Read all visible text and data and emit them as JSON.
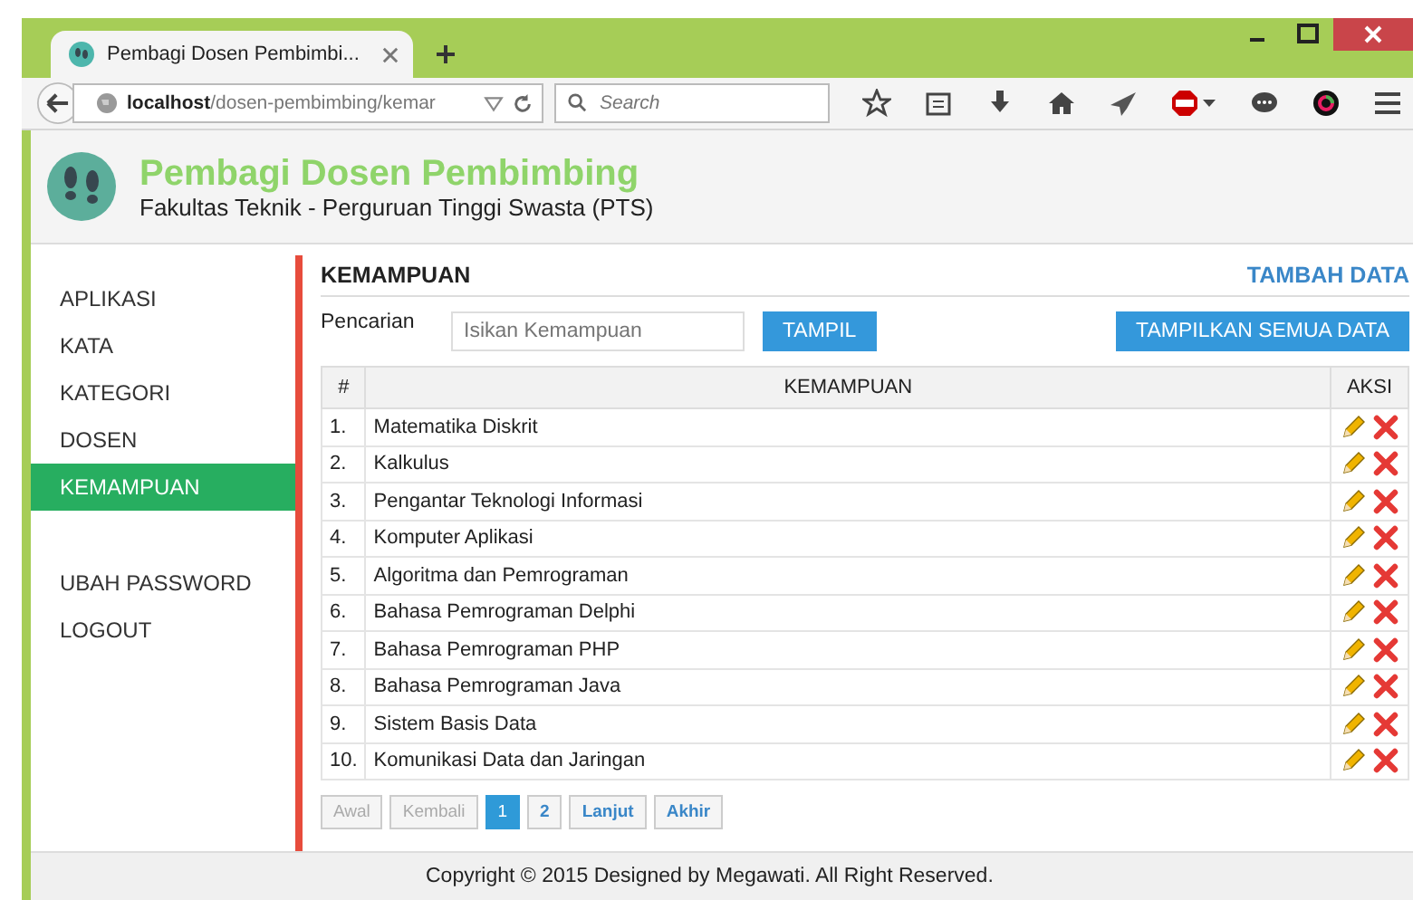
{
  "browser": {
    "tab_title": "Pembagi Dosen Pembimbi...",
    "url_host": "localhost",
    "url_path": "/dosen-pembimbing/kemar",
    "search_placeholder": "Search"
  },
  "header": {
    "title": "Pembagi Dosen Pembimbing",
    "subtitle": "Fakultas Teknik - Perguruan Tinggi Swasta (PTS)"
  },
  "sidebar": {
    "groups": [
      [
        {
          "label": "APLIKASI",
          "selected": false
        },
        {
          "label": "KATA",
          "selected": false
        },
        {
          "label": "KATEGORI",
          "selected": false
        },
        {
          "label": "DOSEN",
          "selected": false
        },
        {
          "label": "KEMAMPUAN",
          "selected": true
        }
      ],
      [
        {
          "label": "UBAH PASSWORD",
          "selected": false
        },
        {
          "label": "LOGOUT",
          "selected": false
        }
      ]
    ]
  },
  "main": {
    "title": "KEMAMPUAN",
    "add_link": "TAMBAH DATA",
    "search_label": "Pencarian",
    "search_placeholder": "Isikan Kemampuan",
    "search_button": "TAMPIL",
    "show_all_button": "TAMPILKAN SEMUA DATA"
  },
  "table": {
    "columns": [
      "#",
      "KEMAMPUAN",
      "AKSI"
    ],
    "rows": [
      {
        "no": "1.",
        "name": "Matematika Diskrit"
      },
      {
        "no": "2.",
        "name": "Kalkulus"
      },
      {
        "no": "3.",
        "name": "Pengantar Teknologi Informasi"
      },
      {
        "no": "4.",
        "name": "Komputer Aplikasi"
      },
      {
        "no": "5.",
        "name": "Algoritma dan Pemrograman"
      },
      {
        "no": "6.",
        "name": "Bahasa Pemrograman Delphi"
      },
      {
        "no": "7.",
        "name": "Bahasa Pemrograman PHP"
      },
      {
        "no": "8.",
        "name": "Bahasa Pemrograman Java"
      },
      {
        "no": "9.",
        "name": "Sistem Basis Data"
      },
      {
        "no": "10.",
        "name": "Komunikasi Data dan Jaringan"
      }
    ]
  },
  "pagination": [
    {
      "label": "Awal",
      "disabled": true,
      "selected": false
    },
    {
      "label": "Kembali",
      "disabled": true,
      "selected": false
    },
    {
      "label": "1",
      "disabled": false,
      "selected": true
    },
    {
      "label": "2",
      "disabled": false,
      "selected": false
    },
    {
      "label": "Lanjut",
      "disabled": false,
      "selected": false
    },
    {
      "label": "Akhir",
      "disabled": false,
      "selected": false
    }
  ],
  "footer": "Copyright © 2015 Designed by Megawati. All Right Reserved."
}
